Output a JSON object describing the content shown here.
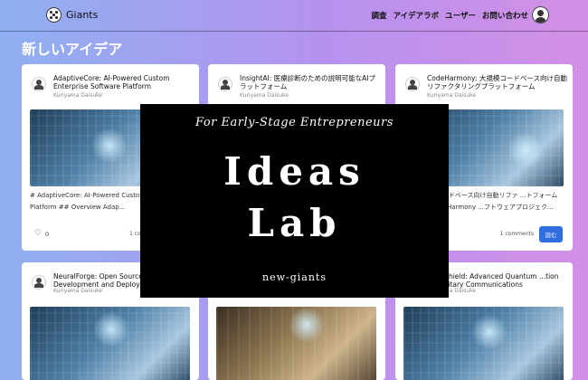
{
  "header": {
    "logo_text": "Giants",
    "nav": [
      "調査",
      "アイデアラボ",
      "ユーザー",
      "お問い合わせ"
    ]
  },
  "page_title": "新しいアイデア",
  "cards": [
    {
      "title": "AdaptiveCore: AI-Powered Custom Enterprise Software Platform",
      "author": "Kuriyama Daisuke",
      "excerpt": "# AdaptiveCore: AI-Powered Custom E... Software Platform ## Overview Adap...",
      "likes": "0",
      "comments": "1 co..."
    },
    {
      "title": "InsightAI: 医療診断のための説明可能なAIプラットフォーム",
      "author": "Kuriyama Daisuke",
      "excerpt": "",
      "likes": "",
      "comments": ""
    },
    {
      "title": "CodeHarmony: 大規模コードベース向け自動リファクタリングプラットフォーム",
      "author": "Kuriyama Daisuke",
      "excerpt": "...y: 大規模コードベース向け自動リファ ...トフォーム ## 概要 CodeHarmony ...フトウェアプロジェク...",
      "likes": "",
      "comments": "1 comments",
      "read_label": "読む"
    },
    {
      "title": "NeuralForge: Open Source A... Development and Deploym...",
      "author": "Kuriyama Daisuke"
    },
    {
      "title": "",
      "author": ""
    },
    {
      "title": "...umShield: Advanced Quantum ...tion for Military Communications",
      "author": "Kuriyama Daisuke"
    }
  ],
  "overlay": {
    "subtitle": "For Early-Stage Entrepreneurs",
    "title_line1": "Ideas",
    "title_line2": "Lab",
    "footer": "new-giants"
  },
  "colors": {
    "accent": "#2f6fe0",
    "background_start": "#8fb0f2",
    "background_end": "#d48fe6"
  }
}
